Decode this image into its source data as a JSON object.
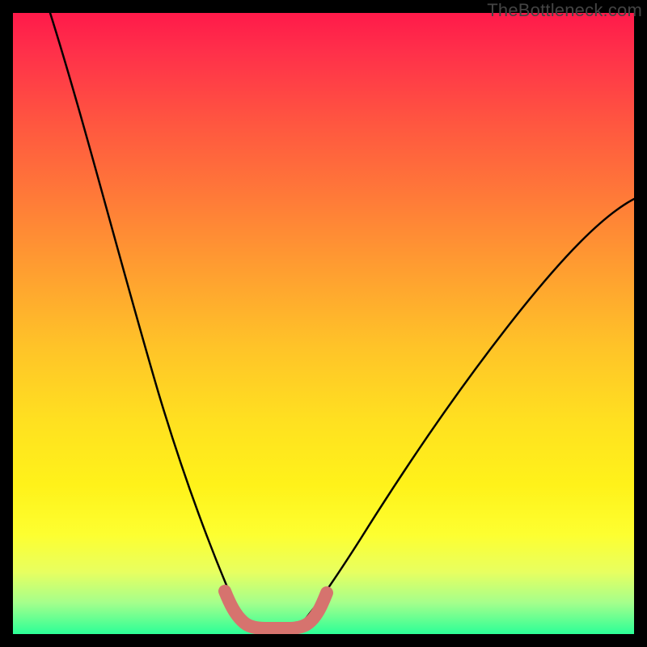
{
  "watermark": "TheBottleneck.com",
  "chart_data": {
    "type": "line",
    "title": "",
    "xlabel": "",
    "ylabel": "",
    "xlim": [
      0,
      100
    ],
    "ylim": [
      0,
      100
    ],
    "series": [
      {
        "name": "left-curve",
        "x": [
          6,
          10,
          14,
          18,
          22,
          25,
          28,
          30,
          32,
          33.5,
          35
        ],
        "values": [
          100,
          80,
          60,
          42,
          27,
          17,
          10,
          6,
          4,
          2,
          1
        ]
      },
      {
        "name": "right-curve",
        "x": [
          45,
          48,
          52,
          58,
          64,
          72,
          80,
          90,
          100
        ],
        "values": [
          1,
          3,
          7,
          14,
          22,
          33,
          44,
          57,
          69
        ]
      },
      {
        "name": "bottom-bracket",
        "x": [
          33.5,
          35,
          37,
          40,
          43,
          45,
          46.5
        ],
        "values": [
          4,
          2,
          1,
          1,
          1,
          2,
          4
        ]
      }
    ],
    "colors": {
      "curve": "#000000",
      "bracket": "#d6736e",
      "gradient_top": "#ff1a4a",
      "gradient_bottom": "#2bff97"
    }
  }
}
